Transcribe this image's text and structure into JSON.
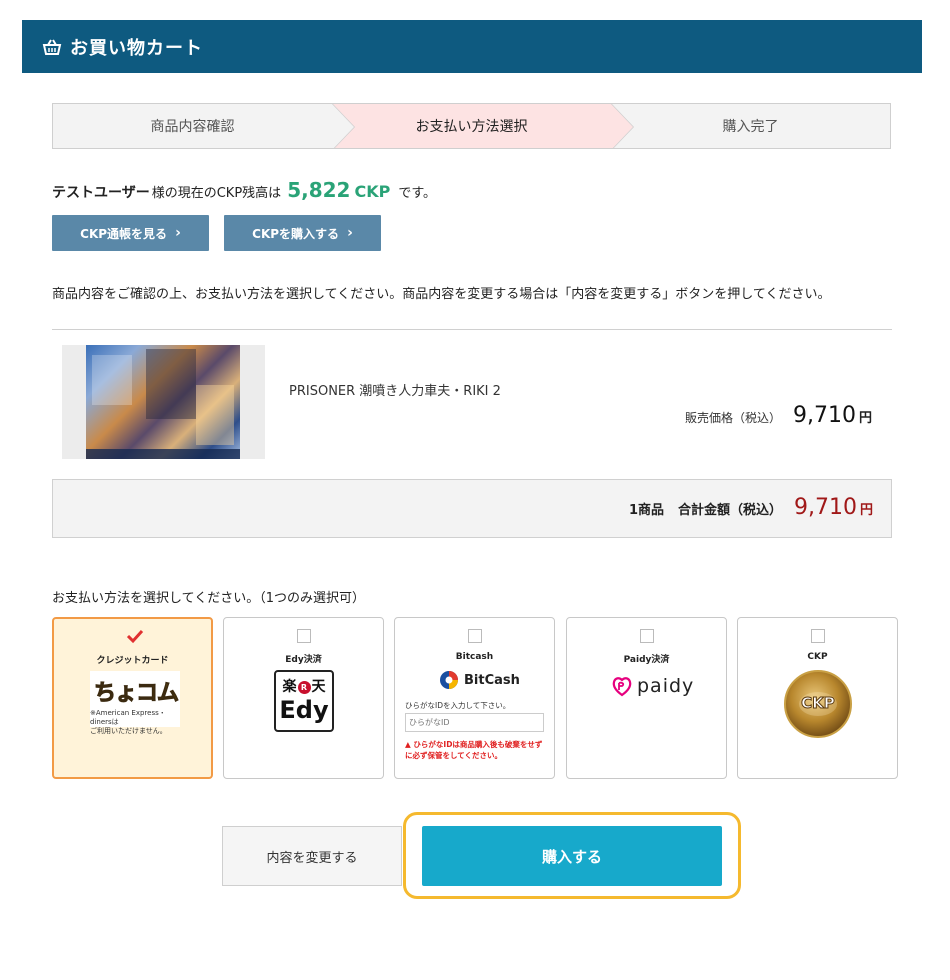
{
  "header": {
    "title": "お買い物カート",
    "icon": "basket-icon"
  },
  "steps": [
    {
      "label": "商品内容確認",
      "active": false
    },
    {
      "label": "お支払い方法選択",
      "active": true
    },
    {
      "label": "購入完了",
      "active": false
    }
  ],
  "balance": {
    "user": "テストユーザー",
    "middle": "様の現在のCKP残高は",
    "amount": "5,822",
    "unit": "CKP",
    "suffix": "です。"
  },
  "buttons": {
    "passbook": "CKP通帳を見る",
    "purchase_ckp": "CKPを購入する",
    "change": "内容を変更する",
    "buy": "購入する"
  },
  "instruction": "商品内容をご確認の上、お支払い方法を選択してください。商品内容を変更する場合は「内容を変更する」ボタンを押してください。",
  "product": {
    "name": "PRISONER 潮噴き人力車夫・RIKI 2",
    "price_label": "販売価格（税込）",
    "price": "9,710",
    "yen": "円"
  },
  "total": {
    "count": "1商品",
    "label": "合計金額（税込）",
    "amount": "9,710",
    "yen": "円"
  },
  "payment": {
    "prompt": "お支払い方法を選択してください。（1つのみ選択可）",
    "methods": [
      {
        "label": "クレジットカード",
        "selected": true,
        "logo": "ちょコム",
        "note": "※American Express・dinersは\nご利用いただけません。"
      },
      {
        "label": "Edy決済",
        "selected": false,
        "logo_top": "楽",
        "logo_mark": "R",
        "logo_top2": "天",
        "logo_bottom": "Edy"
      },
      {
        "label": "Bitcash",
        "selected": false,
        "logo": "BitCash",
        "hint": "ひらがなIDを入力して下さい。",
        "placeholder": "ひらがなID",
        "warning_pre": "ひらがなIDは商品購入後も",
        "warning_red": "破棄をせずに必ず保管をしてください。"
      },
      {
        "label": "Paidy決済",
        "selected": false,
        "logo": "paidy"
      },
      {
        "label": "CKP",
        "selected": false,
        "logo": "CKP"
      }
    ]
  },
  "colors": {
    "header_bg": "#0e5a80",
    "step_active": "#fde3e3",
    "ckp_green": "#2aa377",
    "total_red": "#a01818",
    "buy_btn": "#17a9cb",
    "buy_outline": "#f5b92e",
    "selected_card_bg": "#fff3d9",
    "selected_card_border": "#f29a45"
  }
}
